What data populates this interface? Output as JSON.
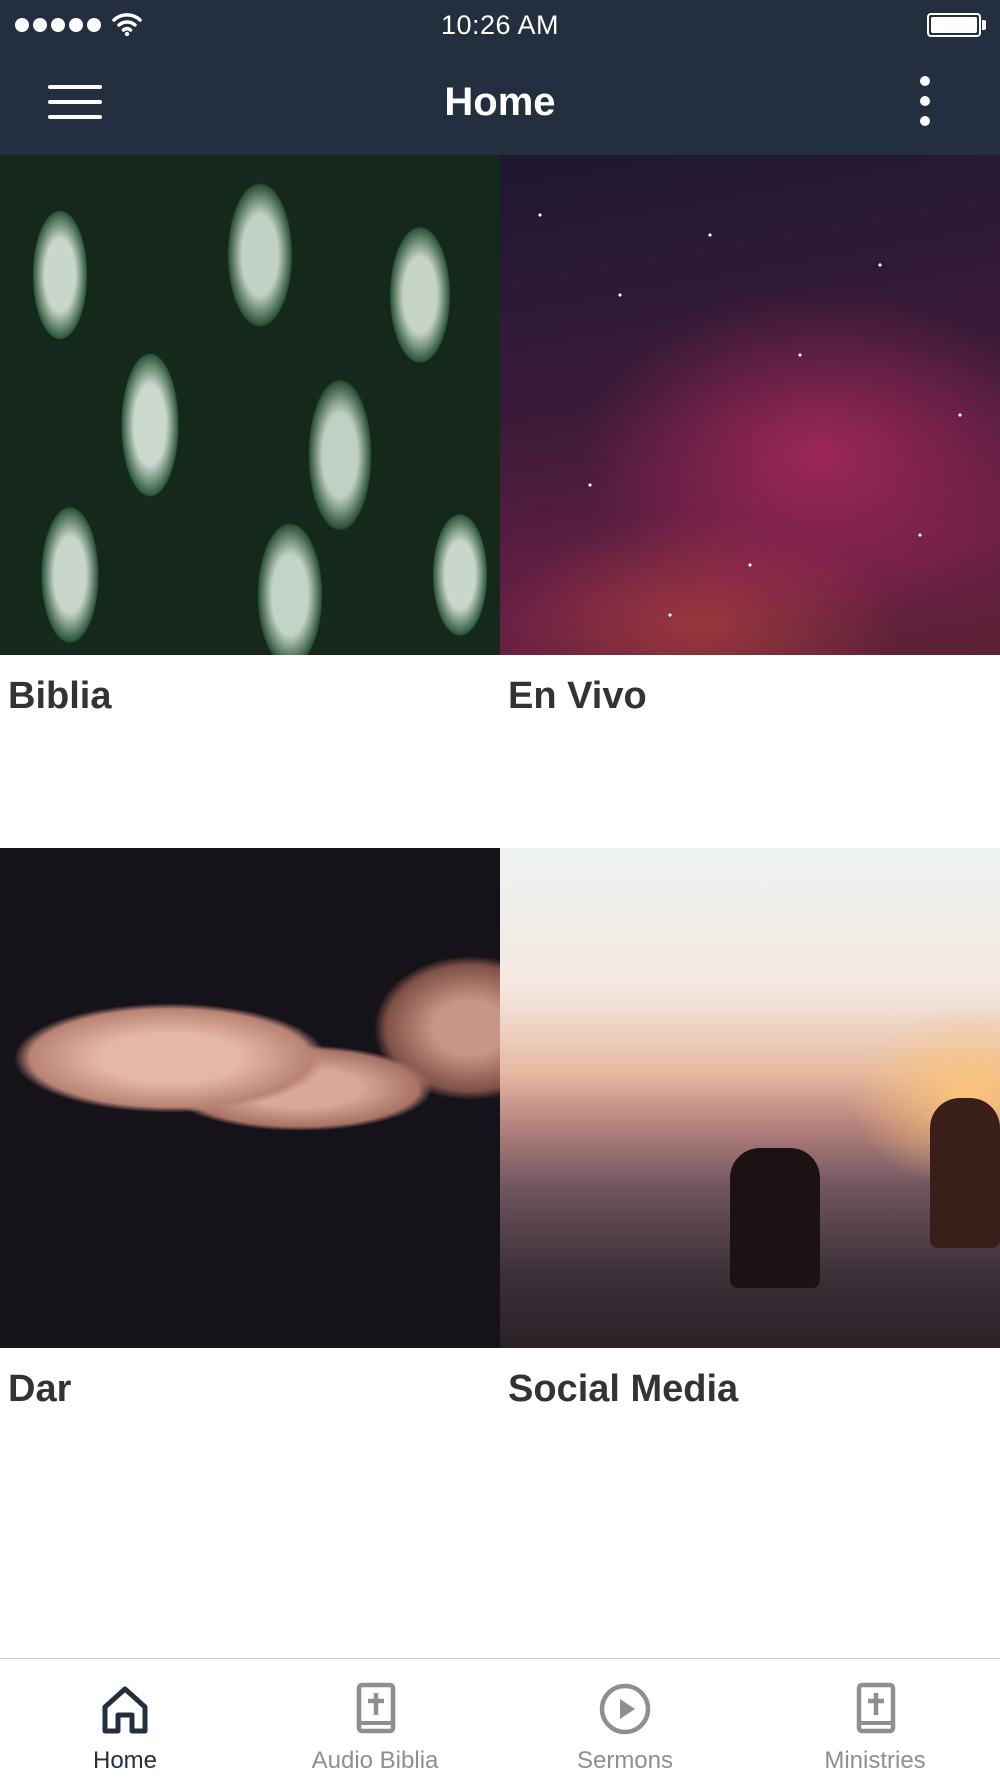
{
  "status_bar": {
    "time": "10:26 AM",
    "signal_icon": "signal-dots-icon",
    "wifi_icon": "wifi-icon",
    "battery_icon": "battery-icon"
  },
  "nav_bar": {
    "title": "Home",
    "menu_icon": "hamburger-menu-icon",
    "more_icon": "more-vertical-icon",
    "background": "#232f3e"
  },
  "tiles": [
    {
      "label": "Biblia",
      "image": "green-leaves-photo"
    },
    {
      "label": "En Vivo",
      "image": "starry-night-sky-photo"
    },
    {
      "label": "Dar",
      "image": "open-hands-photo"
    },
    {
      "label": "Social Media",
      "image": "sunset-mountain-people-photo"
    }
  ],
  "tab_bar": {
    "active_color": "#232f3e",
    "inactive_color": "#8e8e93",
    "tabs": [
      {
        "label": "Home",
        "icon": "home-icon",
        "active": true
      },
      {
        "label": "Audio Biblia",
        "icon": "bible-icon",
        "active": false
      },
      {
        "label": "Sermons",
        "icon": "play-circle-icon",
        "active": false
      },
      {
        "label": "Ministries",
        "icon": "bible-icon",
        "active": false
      }
    ]
  }
}
